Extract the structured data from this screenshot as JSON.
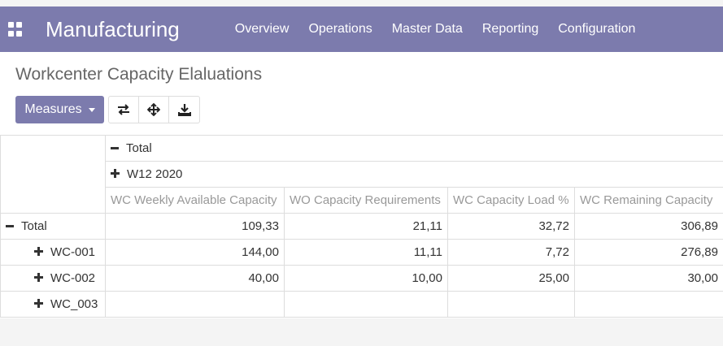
{
  "app": {
    "title": "Manufacturing",
    "apps_icon": "grid-icon"
  },
  "menu": {
    "items": [
      "Overview",
      "Operations",
      "Master Data",
      "Reporting",
      "Configuration"
    ]
  },
  "page": {
    "title": "Workcenter Capacity Elaluations"
  },
  "toolbar": {
    "measures_label": "Measures",
    "buttons": [
      "flip-axis-icon",
      "expand-all-icon",
      "download-icon"
    ]
  },
  "pivot": {
    "col_total_label": "Total",
    "col_group_label": "W12 2020",
    "measures": [
      "WC Weekly Available Capacity",
      "WO Capacity Requirements",
      "WC Capacity Load %",
      "WC Remaining Capacity"
    ],
    "rows": [
      {
        "label": "Total",
        "values": [
          "109,33",
          "21,11",
          "32,72",
          "306,89"
        ]
      },
      {
        "label": "WC-001",
        "values": [
          "144,00",
          "11,11",
          "7,72",
          "276,89"
        ]
      },
      {
        "label": "WC-002",
        "values": [
          "40,00",
          "10,00",
          "25,00",
          "30,00"
        ]
      },
      {
        "label": "WC_003",
        "values": [
          "",
          "",
          "",
          ""
        ]
      }
    ]
  },
  "colors": {
    "brand": "#7c7bad",
    "header_text": "#999999"
  }
}
